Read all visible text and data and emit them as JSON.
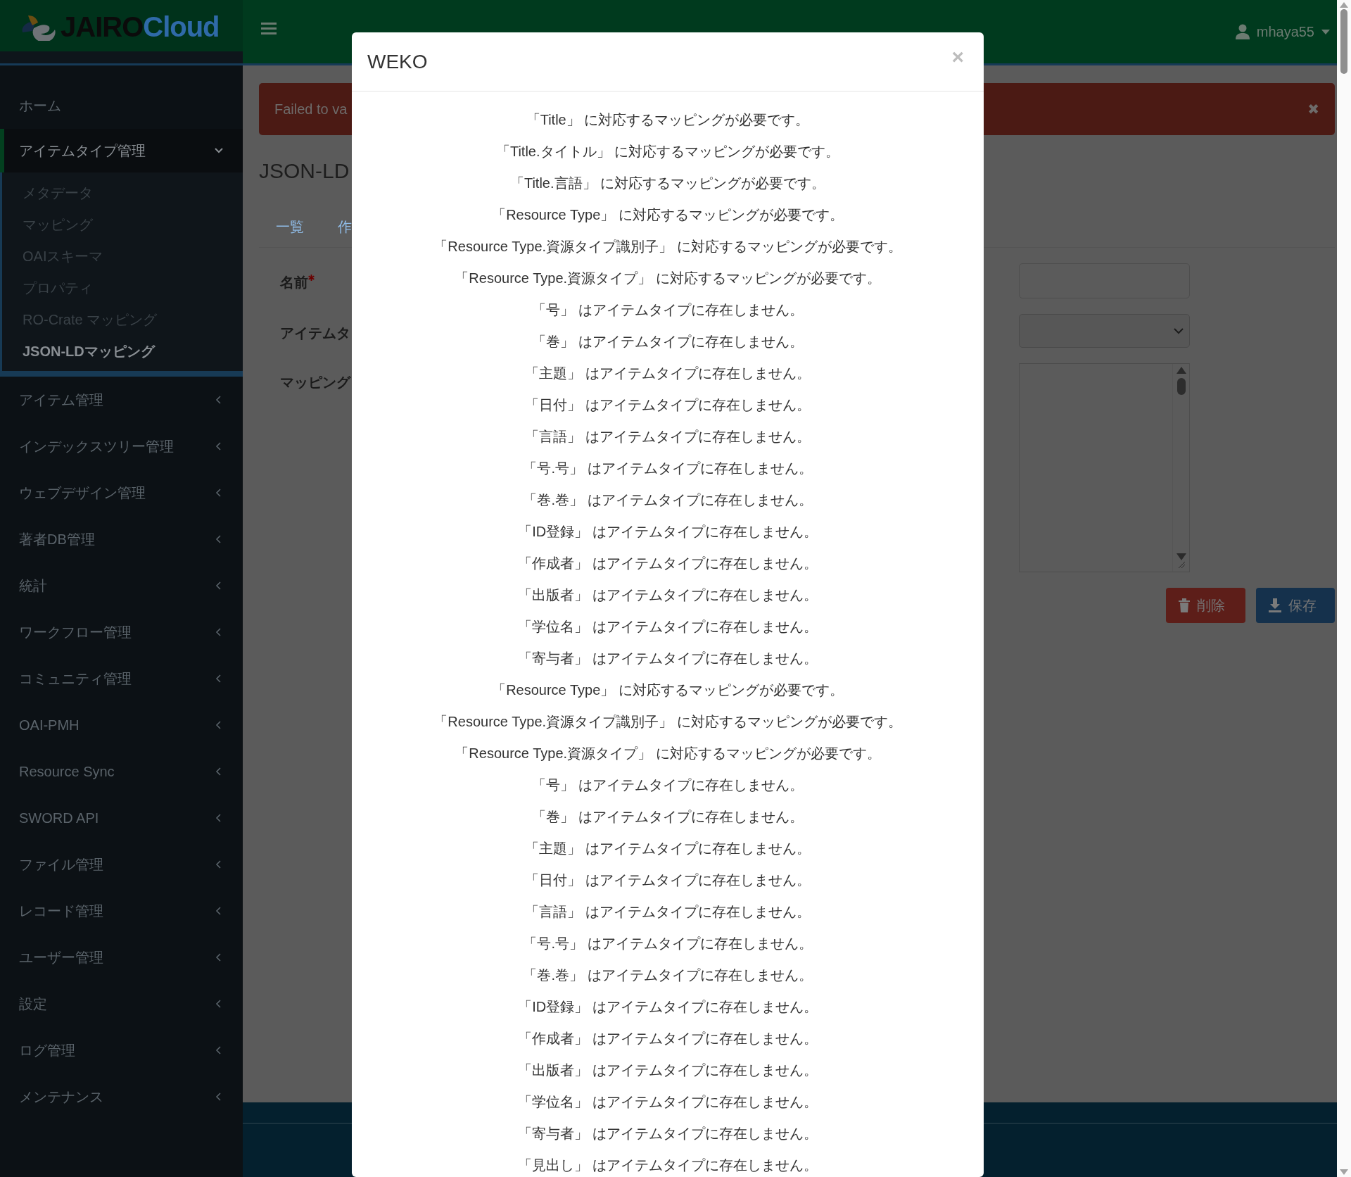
{
  "header": {
    "logo": {
      "part1": "JAIRO",
      "part2": "Cloud"
    },
    "user": "mhaya55"
  },
  "sidebar": {
    "items": [
      {
        "label": "ホーム",
        "kind": "link"
      },
      {
        "label": "アイテムタイプ管理",
        "kind": "group",
        "expanded": true,
        "children": [
          {
            "label": "メタデータ",
            "selected": false
          },
          {
            "label": "マッピング",
            "selected": false
          },
          {
            "label": "OAIスキーマ",
            "selected": false
          },
          {
            "label": "プロパティ",
            "selected": false
          },
          {
            "label": "RO-Crate マッピング",
            "selected": false
          },
          {
            "label": "JSON-LDマッピング",
            "selected": true
          }
        ]
      },
      {
        "label": "アイテム管理",
        "kind": "group",
        "expanded": false
      },
      {
        "label": "インデックスツリー管理",
        "kind": "group",
        "expanded": false
      },
      {
        "label": "ウェブデザイン管理",
        "kind": "group",
        "expanded": false
      },
      {
        "label": "著者DB管理",
        "kind": "group",
        "expanded": false
      },
      {
        "label": "統計",
        "kind": "group",
        "expanded": false
      },
      {
        "label": "ワークフロー管理",
        "kind": "group",
        "expanded": false
      },
      {
        "label": "コミュニティ管理",
        "kind": "group",
        "expanded": false
      },
      {
        "label": "OAI-PMH",
        "kind": "group",
        "expanded": false
      },
      {
        "label": "Resource Sync",
        "kind": "group",
        "expanded": false
      },
      {
        "label": "SWORD API",
        "kind": "group",
        "expanded": false
      },
      {
        "label": "ファイル管理",
        "kind": "group",
        "expanded": false
      },
      {
        "label": "レコード管理",
        "kind": "group",
        "expanded": false
      },
      {
        "label": "ユーザー管理",
        "kind": "group",
        "expanded": false
      },
      {
        "label": "設定",
        "kind": "group",
        "expanded": false
      },
      {
        "label": "ログ管理",
        "kind": "group",
        "expanded": false
      },
      {
        "label": "メンテナンス",
        "kind": "group",
        "expanded": false
      }
    ]
  },
  "main": {
    "alert": {
      "text": "Failed to va",
      "close": "✖"
    },
    "title": "JSON-LD",
    "tabs": [
      "一覧",
      "作"
    ],
    "form": [
      {
        "label": "名前",
        "required": true,
        "kind": "text"
      },
      {
        "label": "アイテムタ",
        "required": false,
        "kind": "select"
      },
      {
        "label": "マッピング",
        "required": false,
        "kind": "textarea"
      }
    ],
    "buttons": [
      {
        "label": "削除",
        "kind": "danger"
      },
      {
        "label": "保存",
        "kind": "primary"
      }
    ]
  },
  "modal": {
    "title": "WEKO",
    "close": "×",
    "messages": [
      "「Title」 に対応するマッピングが必要です。",
      "「Title.タイトル」 に対応するマッピングが必要です。",
      "「Title.言語」 に対応するマッピングが必要です。",
      "「Resource Type」 に対応するマッピングが必要です。",
      "「Resource Type.資源タイプ識別子」 に対応するマッピングが必要です。",
      "「Resource Type.資源タイプ」 に対応するマッピングが必要です。",
      "「号」 はアイテムタイプに存在しません。",
      "「巻」 はアイテムタイプに存在しません。",
      "「主題」 はアイテムタイプに存在しません。",
      "「日付」 はアイテムタイプに存在しません。",
      "「言語」 はアイテムタイプに存在しません。",
      "「号.号」 はアイテムタイプに存在しません。",
      "「巻.巻」 はアイテムタイプに存在しません。",
      "「ID登録」 はアイテムタイプに存在しません。",
      "「作成者」 はアイテムタイプに存在しません。",
      "「出版者」 はアイテムタイプに存在しません。",
      "「学位名」 はアイテムタイプに存在しません。",
      "「寄与者」 はアイテムタイプに存在しません。",
      "「Resource Type」 に対応するマッピングが必要です。",
      "「Resource Type.資源タイプ識別子」 に対応するマッピングが必要です。",
      "「Resource Type.資源タイプ」 に対応するマッピングが必要です。",
      "「号」 はアイテムタイプに存在しません。",
      "「巻」 はアイテムタイプに存在しません。",
      "「主題」 はアイテムタイプに存在しません。",
      "「日付」 はアイテムタイプに存在しません。",
      "「言語」 はアイテムタイプに存在しません。",
      "「号.号」 はアイテムタイプに存在しません。",
      "「巻.巻」 はアイテムタイプに存在しません。",
      "「ID登録」 はアイテムタイプに存在しません。",
      "「作成者」 はアイテムタイプに存在しません。",
      "「出版者」 はアイテムタイプに存在しません。",
      "「学位名」 はアイテムタイプに存在しません。",
      "「寄与者」 はアイテムタイプに存在しません。",
      "「見出し」 はアイテムタイプに存在しません。"
    ]
  }
}
